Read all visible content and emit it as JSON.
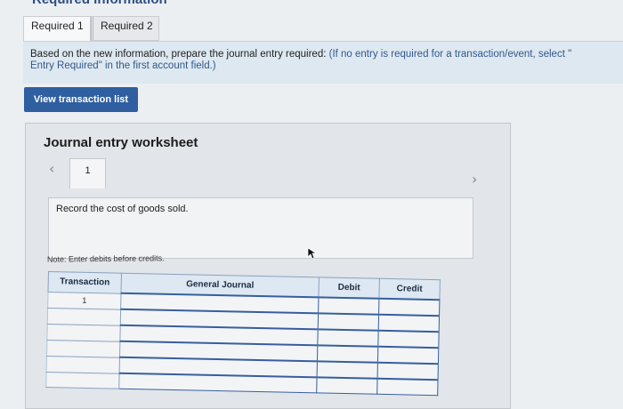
{
  "header": {
    "cut_title": "Required information"
  },
  "tabs": [
    {
      "label": "Required 1",
      "active": true
    },
    {
      "label": "Required 2",
      "active": false
    }
  ],
  "instructions": {
    "line1": "Based on the new information, prepare the journal entry required:",
    "paren1": " (If no entry is required for a transaction/event, select \"",
    "line2": "Entry Required\" in the first account field.)"
  },
  "view_button": {
    "label": "View transaction list"
  },
  "worksheet": {
    "title": "Journal entry worksheet",
    "entry_number": "1",
    "description": "Record the cost of goods sold.",
    "note": "Note: Enter debits before credits."
  },
  "journal": {
    "headers": [
      "Transaction",
      "General Journal",
      "Debit",
      "Credit"
    ],
    "rows": [
      {
        "transaction": "1",
        "account": "",
        "debit": "",
        "credit": ""
      },
      {
        "transaction": "",
        "account": "",
        "debit": "",
        "credit": ""
      },
      {
        "transaction": "",
        "account": "",
        "debit": "",
        "credit": ""
      },
      {
        "transaction": "",
        "account": "",
        "debit": "",
        "credit": ""
      },
      {
        "transaction": "",
        "account": "",
        "debit": "",
        "credit": ""
      },
      {
        "transaction": "",
        "account": "",
        "debit": "",
        "credit": ""
      }
    ]
  },
  "icons": [
    "chevron-left-icon",
    "chevron-right-icon",
    "mouse-cursor-icon"
  ],
  "colors": {
    "button": "#2f5fa0",
    "instructions_bg": "#dde8f1",
    "table_border": "#355f9e"
  }
}
